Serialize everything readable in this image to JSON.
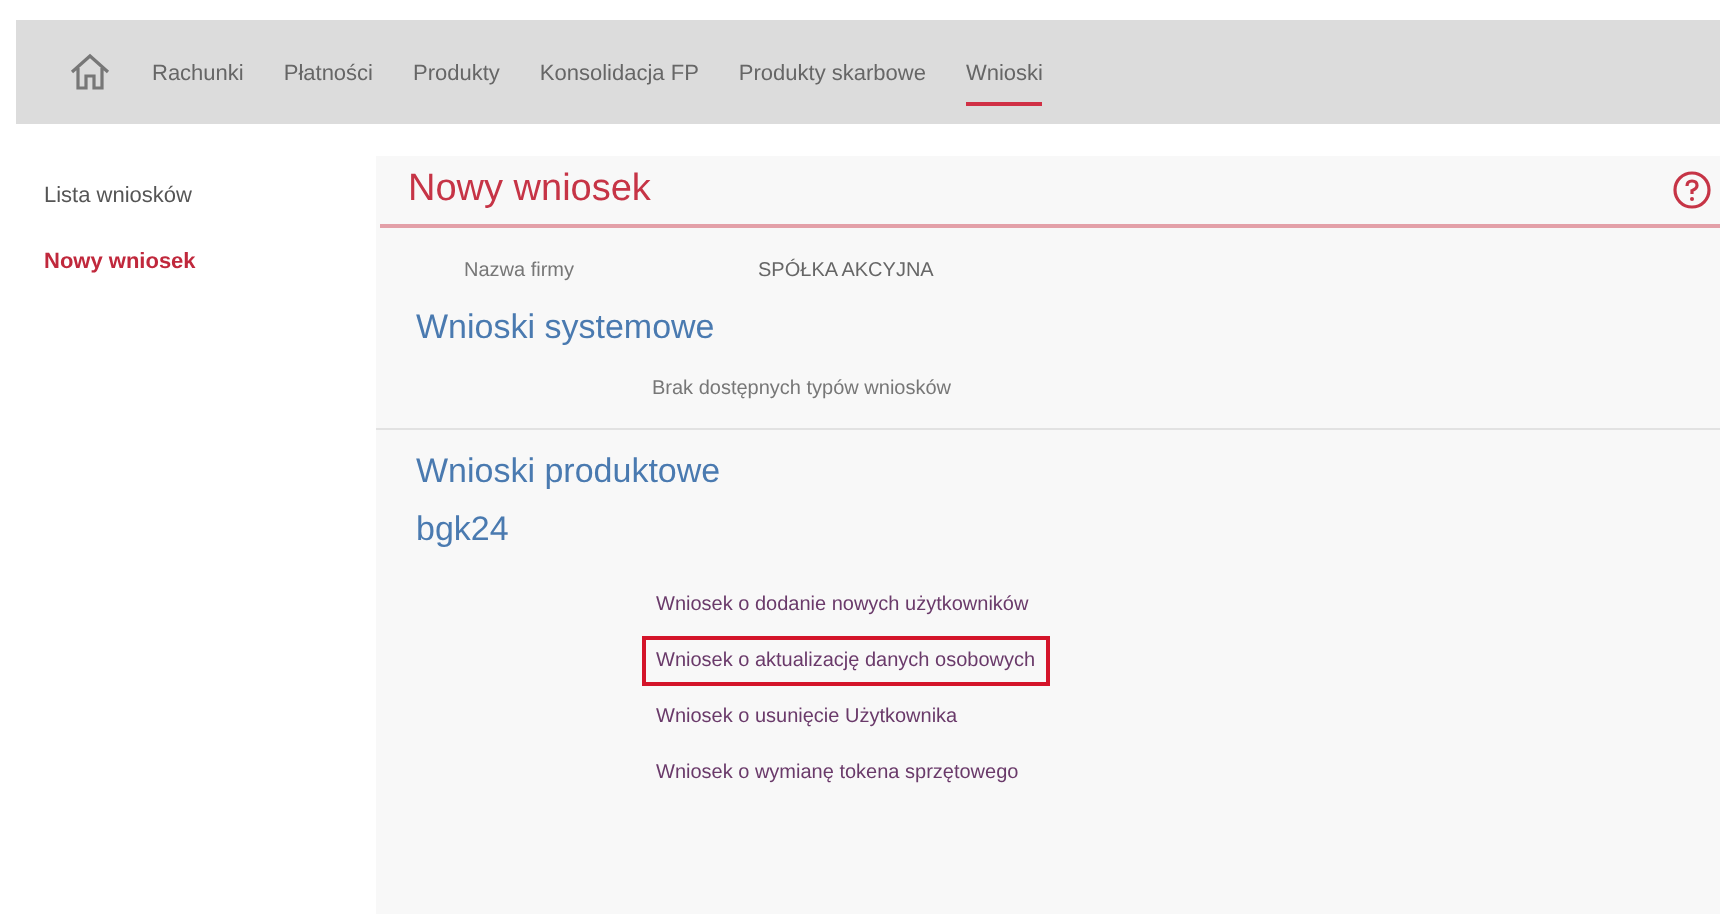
{
  "nav": {
    "items": [
      {
        "label": "Rachunki",
        "selected": false
      },
      {
        "label": "Płatności",
        "selected": false
      },
      {
        "label": "Produkty",
        "selected": false
      },
      {
        "label": "Konsolidacja FP",
        "selected": false
      },
      {
        "label": "Produkty skarbowe",
        "selected": false
      },
      {
        "label": "Wnioski",
        "selected": true
      }
    ]
  },
  "sidebar": {
    "items": [
      {
        "label": "Lista wniosków",
        "selected": false
      },
      {
        "label": "Nowy wniosek",
        "selected": true
      }
    ]
  },
  "page_title": "Nowy wniosek",
  "company": {
    "label": "Nazwa firmy",
    "value": "SPÓŁKA AKCYJNA"
  },
  "system_section": {
    "title": "Wnioski systemowe",
    "message": "Brak dostępnych typów wniosków"
  },
  "product_section": {
    "title": "Wnioski produktowe",
    "group": "bgk24",
    "links": [
      {
        "label": "Wniosek o dodanie nowych użytkowników",
        "highlighted": false
      },
      {
        "label": "Wniosek o aktualizację danych osobowych",
        "highlighted": true
      },
      {
        "label": "Wniosek o usunięcie Użytkownika",
        "highlighted": false
      },
      {
        "label": "Wniosek o wymianę tokena sprzętowego",
        "highlighted": false
      }
    ]
  }
}
